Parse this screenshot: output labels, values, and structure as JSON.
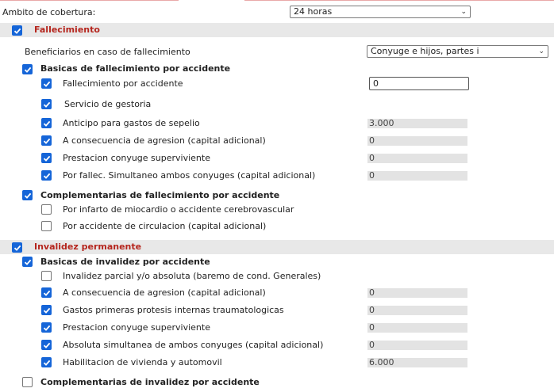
{
  "ambito": {
    "label": "Ambito de cobertura:",
    "value": "24 horas"
  },
  "fallecimiento": {
    "title": "Fallecimiento",
    "checked": true,
    "beneficiarios": {
      "label": "Beneficiarios en caso de fallecimiento",
      "value": "Conyuge e hijos, partes i"
    },
    "basicas": {
      "title": "Basicas de fallecimiento por accidente",
      "checked": true,
      "items": [
        {
          "label": "Fallecimiento por accidente",
          "checked": true,
          "value": "0"
        },
        {
          "label": "Servicio de gestoria",
          "checked": true
        },
        {
          "label": "Anticipo para gastos de sepelio",
          "checked": true,
          "value": "3.000"
        },
        {
          "label": "A consecuencia de agresion (capital adicional)",
          "checked": true,
          "value": "0"
        },
        {
          "label": "Prestacion conyuge superviviente",
          "checked": true,
          "value": "0"
        },
        {
          "label": "Por fallec. Simultaneo ambos conyuges (capital adicional)",
          "checked": true,
          "value": "0"
        }
      ]
    },
    "complementarias": {
      "title": "Complementarias de fallecimiento por accidente",
      "checked": true,
      "items": [
        {
          "label": "Por infarto de miocardio o accidente cerebrovascular",
          "checked": false
        },
        {
          "label": "Por accidente de circulacion (capital adicional)",
          "checked": false
        }
      ]
    }
  },
  "invalidez": {
    "title": "Invalidez permanente",
    "checked": true,
    "basicas": {
      "title": "Basicas de invalidez por accidente",
      "checked": true,
      "items": [
        {
          "label": "Invalidez parcial y/o absoluta (baremo de cond. Generales)",
          "checked": false
        },
        {
          "label": "A consecuencia de agresion (capital adicional)",
          "checked": true,
          "value": "0"
        },
        {
          "label": "Gastos primeras protesis internas traumatologicas",
          "checked": true,
          "value": "0"
        },
        {
          "label": "Prestacion conyuge superviviente",
          "checked": true,
          "value": "0"
        },
        {
          "label": "Absoluta simultanea de ambos conyuges (capital adicional)",
          "checked": true,
          "value": "0"
        },
        {
          "label": "Habilitacion de vivienda y automovil",
          "checked": true,
          "value": "6.000"
        }
      ]
    },
    "complementarias": {
      "title": "Complementarias de invalidez por accidente",
      "checked": false
    }
  },
  "icons": {
    "checkbox_checked": "check-icon",
    "select_arrow": "chevron-down-icon"
  },
  "colors": {
    "checkbox": "#1565d8",
    "section_title": "#b5261e",
    "section_bar": "#e8e8e8"
  }
}
